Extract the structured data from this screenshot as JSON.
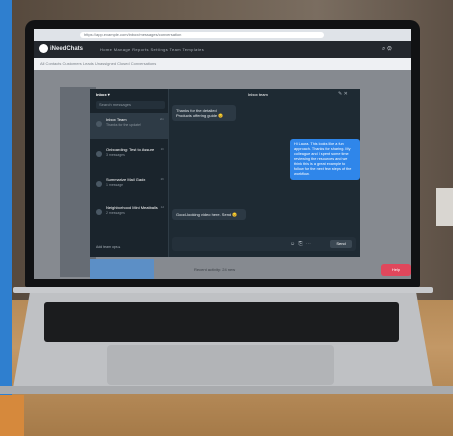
{
  "browser": {
    "url": "https://app.example.com/inbox/messages/conversation"
  },
  "app": {
    "name": "iNeedChats",
    "nav": "Home   Manage   Reports   Settings   Team   Templates",
    "subnav": "All Contacts   Customers   Leads   Unassigned   Closed   Conversations"
  },
  "modal": {
    "title": "Inbox  ▾",
    "search_placeholder": "Search messages",
    "conversations": [
      {
        "title": "Inbox Team",
        "sub": "Thanks for the update!",
        "time": "2m"
      },
      {
        "title": "Onboarding: Test to Assure",
        "sub": "3 messages",
        "time": "1h"
      },
      {
        "title": "Summarize Mail Gadx",
        "sub": "1 message",
        "time": "2h"
      },
      {
        "title": "Neighborhood Mini Meatballs",
        "sub": "2 messages",
        "time": "1d"
      }
    ],
    "footer": "Add team ops ▸",
    "chat_header": "Inbox team",
    "messages": {
      "in_1": "Thanks for the detailed Products offering guide 😊",
      "out_1": "Hi Laura. This looks like a fun approach. Thanks for sharing. My colleague and I spent some time reviewing the resources and we think this is a great example to follow for the next few steps of the workflow.",
      "in_2": "Good-looking video here. Send 😊",
      "send": "Send"
    }
  },
  "page": {
    "bottom_text": "Recent activity: 24 new",
    "cta": "Help"
  }
}
